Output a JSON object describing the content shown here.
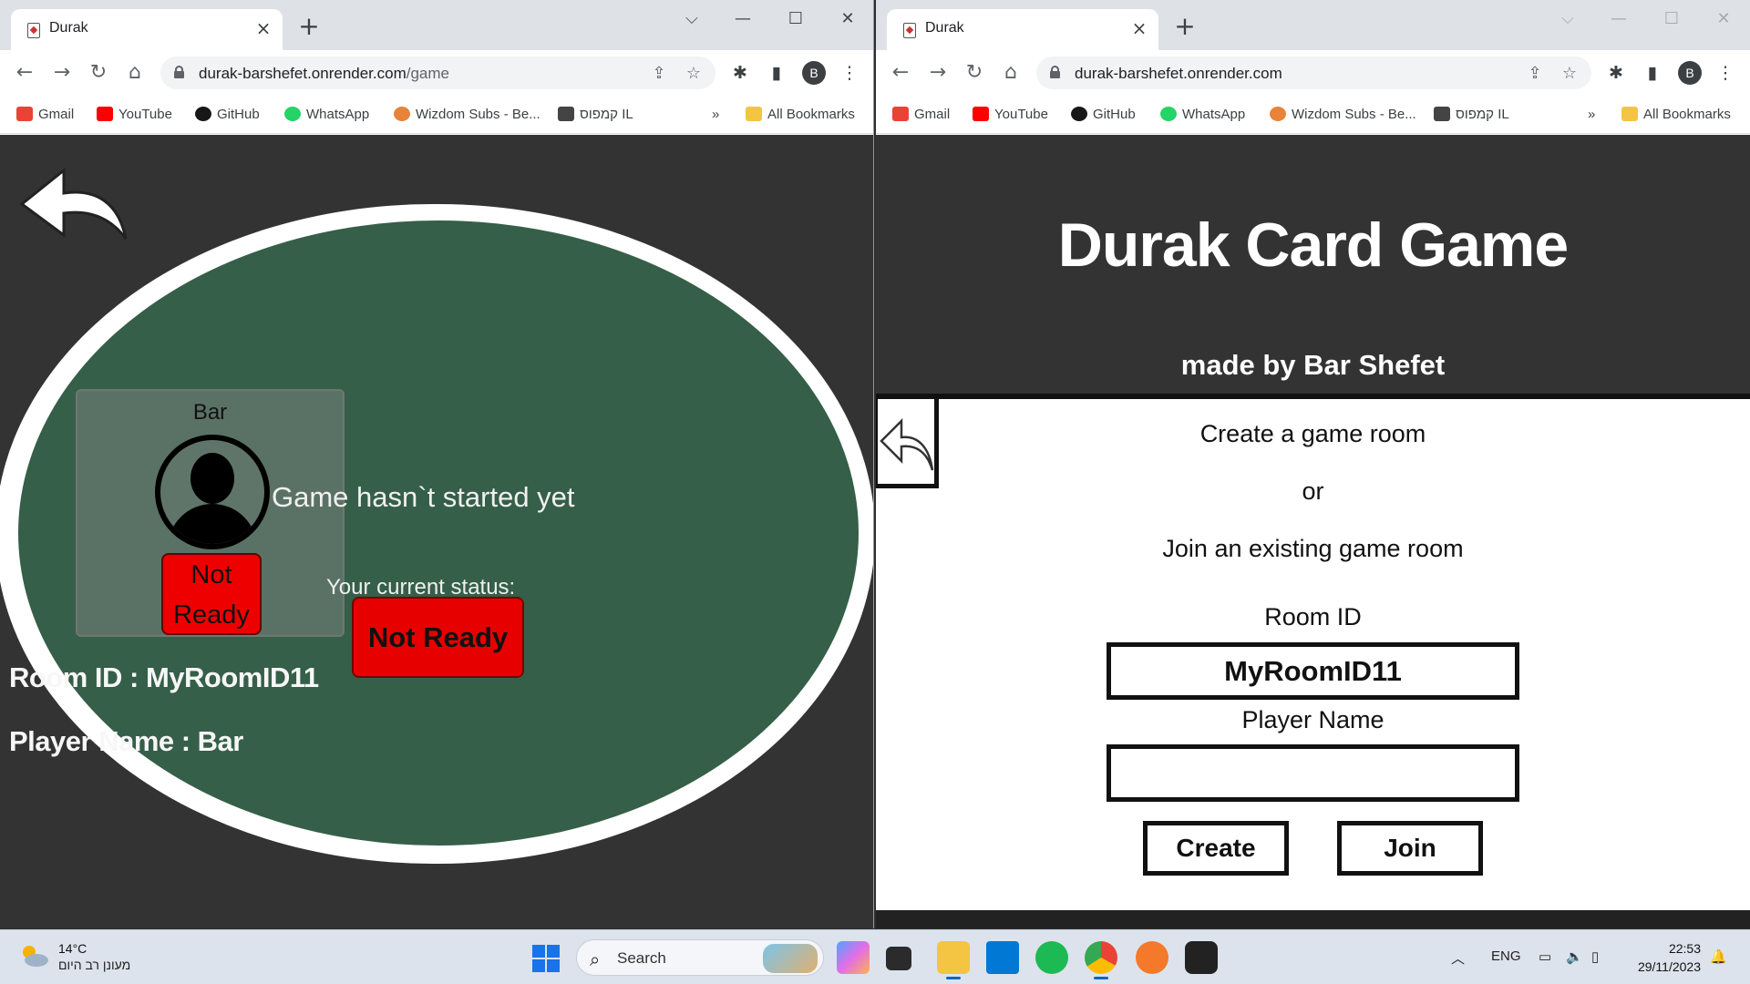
{
  "left_window": {
    "tab": {
      "title": "Durak"
    },
    "address": {
      "host": "durak-barshefet.onrender.com",
      "path": "/game"
    },
    "avatar_letter": "B"
  },
  "right_window": {
    "tab": {
      "title": "Durak"
    },
    "address": {
      "host": "durak-barshefet.onrender.com",
      "path": ""
    },
    "avatar_letter": "B"
  },
  "bookmarks": [
    {
      "label": "Gmail",
      "icon": "gmail-icon",
      "color": "#ea4335"
    },
    {
      "label": "YouTube",
      "icon": "youtube-icon",
      "color": "#ff0000"
    },
    {
      "label": "GitHub",
      "icon": "github-icon",
      "color": "#181717"
    },
    {
      "label": "WhatsApp",
      "icon": "whatsapp-icon",
      "color": "#25d366"
    },
    {
      "label": "Wizdom Subs - Be...",
      "icon": "wizdom-icon",
      "color": "#e8833a"
    },
    {
      "label": "קמפוס IL",
      "icon": "campus-icon",
      "color": "#444444"
    }
  ],
  "bookmarks_overflow": "»",
  "all_bookmarks": "All Bookmarks",
  "game": {
    "player_name": "Bar",
    "player_status": "Not Ready",
    "game_status": "Game hasn`t started yet",
    "current_status_label": "Your current status:",
    "ready_button": "Not Ready",
    "room_id_line": "Room ID : MyRoomID11",
    "player_name_line": "Player Name : Bar",
    "colors": {
      "table": "#355f48",
      "background": "#333333",
      "status_red": "#e60000"
    }
  },
  "lobby": {
    "title": "Durak Card Game",
    "subtitle": "made by Bar Shefet",
    "create_text": "Create a game room",
    "or_text": "or",
    "join_text": "Join an existing game room",
    "room_id_label": "Room ID",
    "room_id_value": "MyRoomID11",
    "player_name_label": "Player Name",
    "player_name_value": "",
    "create_button": "Create",
    "join_button": "Join"
  },
  "taskbar": {
    "weather_temp": "14°C",
    "weather_desc": "מעונן רב היום",
    "search_placeholder": "Search",
    "language": "ENG",
    "time": "22:53",
    "date": "29/11/2023",
    "apps": [
      "copilot-icon",
      "file-explorer-icon",
      "folder-icon",
      "vscode-icon",
      "spotify-icon",
      "chrome-icon",
      "blender-icon",
      "davinci-icon"
    ]
  }
}
